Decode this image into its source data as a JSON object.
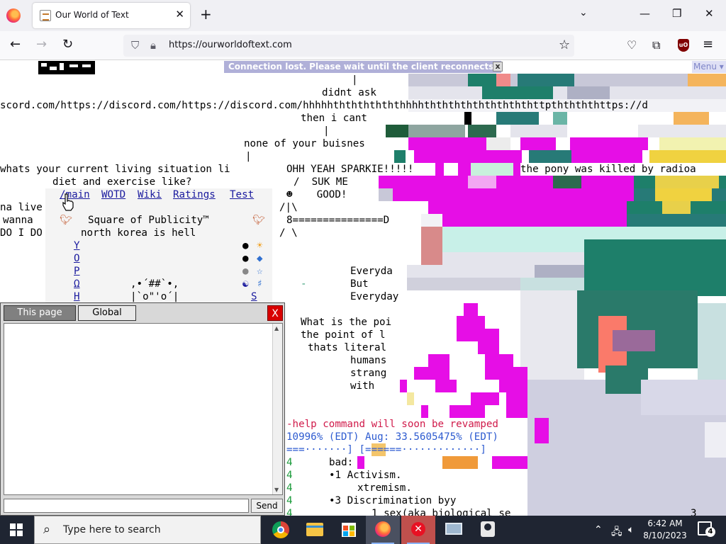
{
  "browser": {
    "tab_title": "Our World of Text",
    "url_host": "https://ourworldoftext.com",
    "new_tab_symbol": "+"
  },
  "page": {
    "connection_banner": "Connection lost. Please wait until the client reconnects.",
    "connection_close": "x",
    "menu_label": "Menu ▾",
    "text_lines": {
      "l1": "didnt ask",
      "l2": "scord.com/https://discord.com/https://discord.com/hhhhhththththththhhhthththththththththttpththththttps://d",
      "l3": "then i cant",
      "l4": "|",
      "l5": "none of your buisnes",
      "l6": "|",
      "l7": "whats your current living situation li",
      "l8": "diet and exercise like?",
      "l9": "OHH YEAH SPARKIE!!!!!",
      "l10": "/  SUK ME",
      "l11": "☻    GOOD!",
      "l12": "/|\\",
      "l13": "8===============D",
      "l14": "/ \\",
      "l15": "the pony was killed by radioa",
      "l16": "na live",
      "l17": "wanna",
      "l18": "DO I DO",
      "l19": "Square of Publicity™",
      "l20": "north korea is hell",
      "l21": "Everyda",
      "l22": "But",
      "l23": "Everyday",
      "l24": "What is the poi",
      "l25": "the point of l",
      "l26": "thats literal",
      "l27": "humans",
      "l28": "strang",
      "l29": "with",
      "l30": "-help command will soon be revamped",
      "l31": "10996% (EDT) Aug: 33.5605475% (EDT)",
      "l32": "===·······] [======·············]",
      "l33": "bad:",
      "l34": "•1 Activism.",
      "l35": "xtremism.",
      "l36": "•3 Discrimination byy",
      "l37": "1 sex(aka biological se",
      "l38": ",•´##`•,",
      "l39": "|`o\"'o´|",
      "l40": "3"
    },
    "nav_links": [
      "/main",
      "WOTD",
      "Wiki",
      "Ratings",
      "Test"
    ],
    "vertical_letters": [
      "Y",
      "O",
      "P",
      "Ω",
      "H",
      "S"
    ],
    "left_digits": [
      "4",
      "4",
      "4",
      "4",
      "4",
      "4"
    ],
    "emoji_icons": [
      "bird-icon",
      "bird-icon",
      "sun-icon",
      "diamond-icon",
      "star-icon",
      "yin-yang-icon"
    ]
  },
  "chat": {
    "tab_this_page": "This page",
    "tab_global": "Global",
    "close_label": "X",
    "send_label": "Send",
    "input_value": ""
  },
  "taskbar": {
    "search_placeholder": "Type here to search",
    "time": "6:42 AM",
    "date": "8/10/2023",
    "notification_count": "4"
  },
  "colors": {
    "magenta": "#e60ee6",
    "teal": "#1e7f6a",
    "chat_close": "#d80000",
    "banner": "#b0b0d8"
  }
}
